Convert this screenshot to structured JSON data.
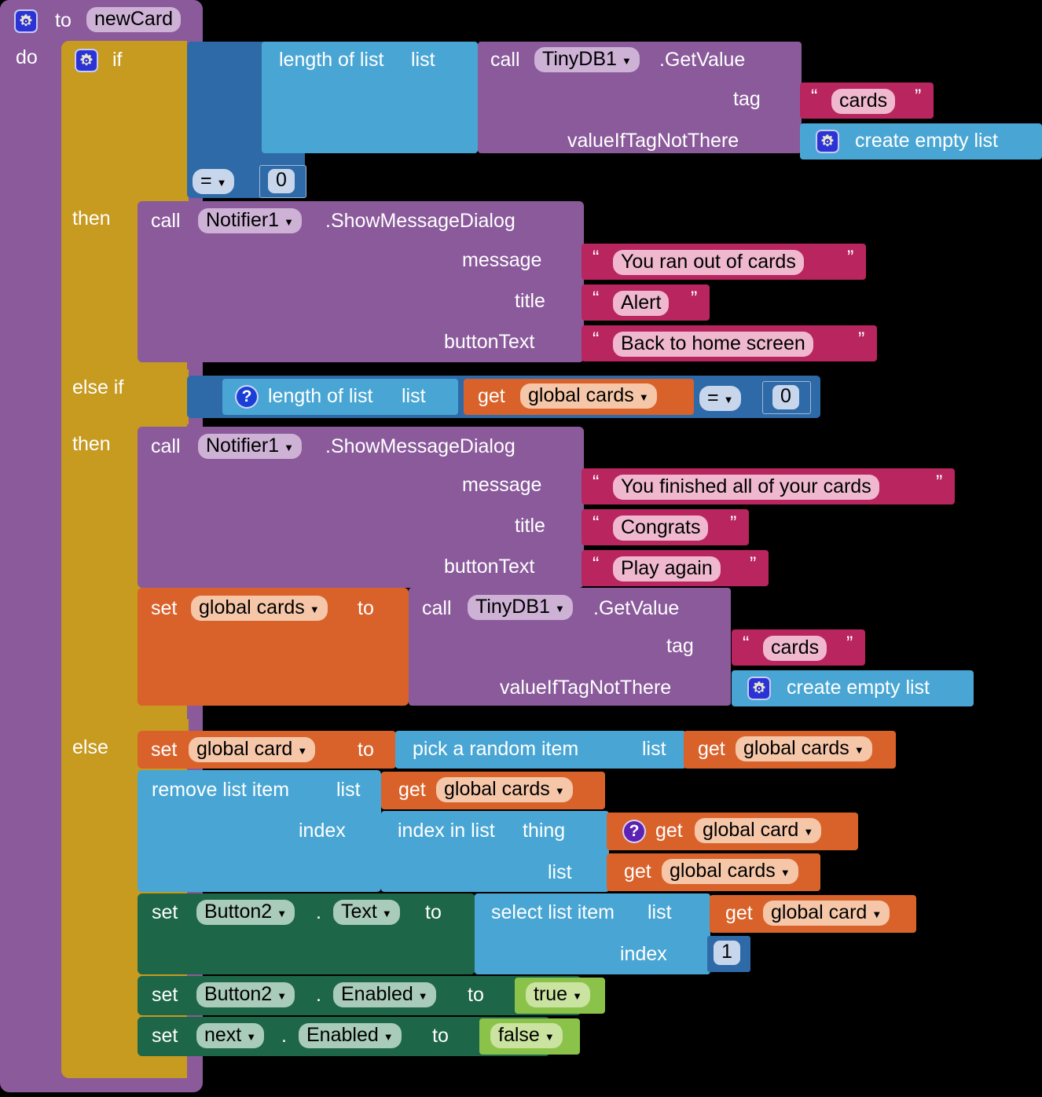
{
  "procedure": {
    "keyword_to": "to",
    "name": "newCard",
    "keyword_do": "do"
  },
  "control": {
    "if_label": "if",
    "then_label_1": "then",
    "elseif_label": "else if",
    "then_label_2": "then",
    "else_label": "else"
  },
  "condition1": {
    "length_of_list": "length of list",
    "list_socket": "list",
    "call": "call",
    "component": "TinyDB1",
    "method": ".GetValue",
    "tag_label": "tag",
    "tag_value": "cards",
    "valueif_label": "valueIfTagNotThere",
    "create_empty_list": "create empty list",
    "operator": "=",
    "compare_value": "0"
  },
  "dialog1": {
    "call": "call",
    "component": "Notifier1",
    "method": ".ShowMessageDialog",
    "message_label": "message",
    "message_value": "You ran out of cards",
    "title_label": "title",
    "title_value": "Alert",
    "buttontext_label": "buttonText",
    "buttontext_value": "Back to home screen"
  },
  "condition2": {
    "length_of_list": "length of list",
    "list_socket": "list",
    "get": "get",
    "variable": "global cards",
    "operator": "=",
    "compare_value": "0"
  },
  "dialog2": {
    "call": "call",
    "component": "Notifier1",
    "method": ".ShowMessageDialog",
    "message_label": "message",
    "message_value": "You finished all of your cards",
    "title_label": "title",
    "title_value": "Congrats",
    "buttontext_label": "buttonText",
    "buttontext_value": "Play again"
  },
  "set_cards": {
    "set": "set",
    "variable": "global cards",
    "to": "to",
    "call": "call",
    "component": "TinyDB1",
    "method": ".GetValue",
    "tag_label": "tag",
    "tag_value": "cards",
    "valueif_label": "valueIfTagNotThere",
    "create_empty_list": "create empty list"
  },
  "else_body": {
    "set_card": {
      "set": "set",
      "variable": "global card",
      "to": "to",
      "pick_random": "pick a random item",
      "list_socket": "list",
      "get": "get",
      "source_variable": "global cards"
    },
    "remove_item": {
      "remove_list_item": "remove list item",
      "list_socket": "list",
      "get": "get",
      "list_variable": "global cards",
      "index_label": "index",
      "index_in_list": "index in list",
      "thing_socket": "thing",
      "thing_get": "get",
      "thing_variable": "global card",
      "inner_list_label": "list",
      "inner_list_get": "get",
      "inner_list_variable": "global cards"
    },
    "set_button_text": {
      "set": "set",
      "component": "Button2",
      "dot": ".",
      "property": "Text",
      "to": "to",
      "select_list_item": "select list item",
      "list_socket": "list",
      "get": "get",
      "variable": "global card",
      "index_label": "index",
      "index_value": "1"
    },
    "set_button_enabled": {
      "set": "set",
      "component": "Button2",
      "dot": ".",
      "property": "Enabled",
      "to": "to",
      "value": "true"
    },
    "set_next_enabled": {
      "set": "set",
      "component": "next",
      "dot": ".",
      "property": "Enabled",
      "to": "to",
      "value": "false"
    }
  },
  "icons": {
    "mutator_gear": "gear-icon",
    "help_badge": "question-icon",
    "dropdown_caret": "chevron-down-icon"
  },
  "colors": {
    "procedure": "#8a5a9b",
    "control": "#c79a20",
    "logic": "#3b71b9",
    "list": "#49a6d4",
    "text": "#b8255f",
    "variable": "#d9622b",
    "component_set": "#1d6647",
    "boolean": "#8bc34a"
  }
}
